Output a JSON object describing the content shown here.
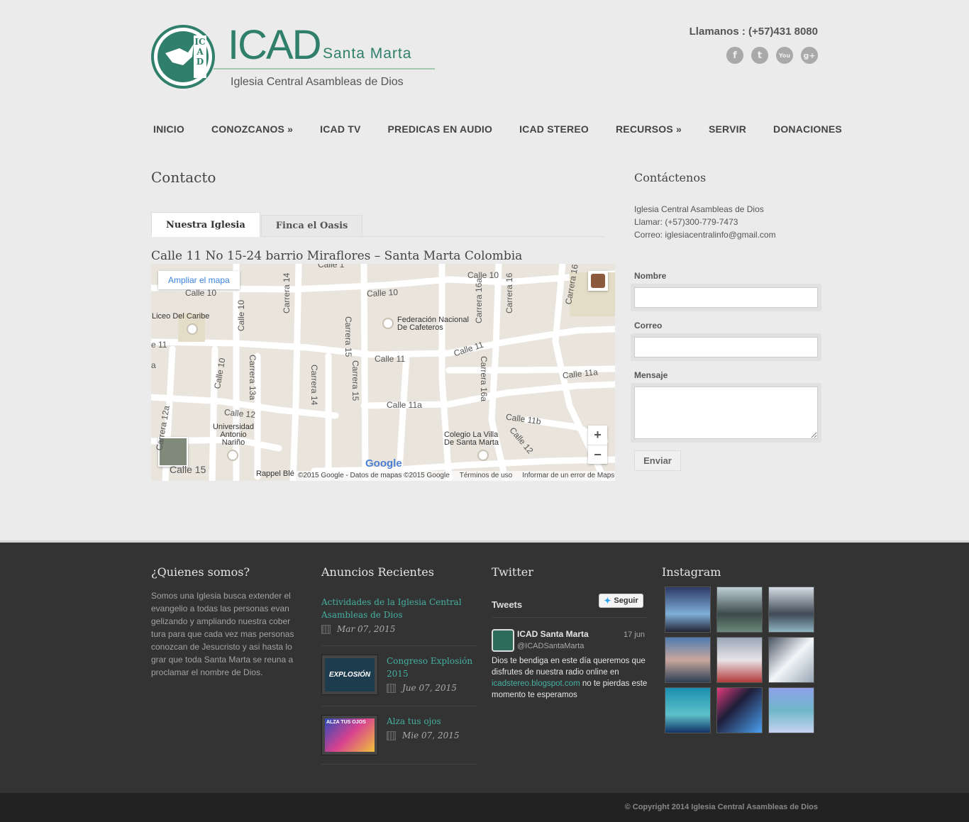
{
  "header": {
    "logo_main": "ICAD",
    "logo_city": "Santa Marta",
    "logo_sub": "Iglesia Central Asambleas de Dios",
    "seal_letters": "ICAD",
    "seal_text": "Santa Marta",
    "phone": "Llamanos : (+57)431 8080",
    "social": [
      {
        "name": "facebook-icon",
        "glyph": "f"
      },
      {
        "name": "twitter-icon",
        "glyph": "t"
      },
      {
        "name": "youtube-icon",
        "glyph": "You"
      },
      {
        "name": "google-plus-icon",
        "glyph": "g+"
      }
    ]
  },
  "nav": {
    "items": [
      {
        "label": "INICIO"
      },
      {
        "label": "CONOZCANOS",
        "arrow": "»"
      },
      {
        "label": "ICAD TV"
      },
      {
        "label": "PREDICAS EN AUDIO"
      },
      {
        "label": "ICAD STEREO"
      },
      {
        "label": "RECURSOS",
        "arrow": "»"
      },
      {
        "label": "SERVIR"
      },
      {
        "label": "DONACIONES"
      }
    ]
  },
  "main": {
    "title": "Contacto",
    "tabs": [
      {
        "label": "Nuestra Iglesia"
      },
      {
        "label": "Finca el Oasis"
      }
    ],
    "address": "Calle 11 No 15-24 barrio Miraflores – Santa Marta Colombia",
    "map": {
      "enlarge": "Ampliar el mapa",
      "google": "Google",
      "footer": [
        "©2015 Google - Datos de mapas ©2015 Google",
        "Términos de uso",
        "Informar de un error de Maps"
      ],
      "zoom_in": "+",
      "zoom_out": "−",
      "streets": [
        "Calle 10",
        "Calle 10",
        "Calle 10",
        "Calle 11",
        "Calle 11",
        "Calle 11a",
        "Calle 11a",
        "Calle 12",
        "Calle 11b",
        "Calle 12",
        "Calle 15",
        "Carrera 14",
        "Carrera 15",
        "Carrera 16a",
        "Carrera 16",
        "Calle 10",
        "Calle 10",
        "Carrera 13a",
        "Carrera 14",
        "Carrera 15",
        "Carrera 16a",
        "Carrera 12a",
        "Calle 1",
        "Carrera 16",
        "e 11",
        "a"
      ],
      "pois": [
        "Liceo Del Caribe",
        "Federación Nacional De Cafeteros",
        "Universidad Antonio Nariño",
        "Colegio La Villa De Santa Marta",
        "Rappel Blé"
      ]
    }
  },
  "sidebar": {
    "title": "Contáctenos",
    "info": [
      "Iglesia Central Asambleas de Dios",
      "Llamar: (+57)300-779-7473",
      "Correo: iglesiacentralinfo@gmail.com"
    ],
    "form": {
      "name_label": "Nombre",
      "email_label": "Correo",
      "message_label": "Mensaje",
      "submit": "Enviar"
    }
  },
  "footer": {
    "about": {
      "title": "¿Quienes somos?",
      "text": "Somos una Iglesia busca extender el evangelio a todas las personas evan gelizando y ampliando nuestra cober tura para que cada vez mas personas conozcan de Jesucristo y asi hasta lo grar que toda Santa Marta se reuna a proclamar el nombre de Dios."
    },
    "news": {
      "title": "Anuncios Recientes",
      "posts": [
        {
          "title": "Actividades de la Iglesia Central Asambleas de Dios",
          "date": "Mar 07, 2015"
        },
        {
          "title": "Congreso Explosión 2015",
          "date": "Jue 07, 2015",
          "thumb_text": "EXPLOSIÓN"
        },
        {
          "title": "Alza tus ojos",
          "date": "Mie 07, 2015",
          "thumb_text": "ALZA TUS OJOS"
        }
      ]
    },
    "twitter": {
      "title": "Twitter",
      "heading": "Tweets",
      "follow": "Seguir",
      "tweet": {
        "name": "ICAD Santa Marta",
        "handle": "@ICADSantaMarta",
        "date": "17 jun",
        "text_before": "Dios te bendiga en este día queremos que disfrutes de nuestra radio online en",
        "link": "icadstereo.blogspot.com",
        "text_after": "no te pierdas este momento te esperamos"
      }
    },
    "instagram": {
      "title": "Instagram",
      "tiles": [
        "#3b4a7a",
        "#4e6a6a",
        "#556270",
        "#3e5f8a",
        "#7a6c7e",
        "#aab6c2",
        "#2a8fa3",
        "#25304a",
        "#6c7bd1"
      ]
    }
  },
  "copyright": "© Copyright 2014 Iglesia Central Asambleas de Dios"
}
